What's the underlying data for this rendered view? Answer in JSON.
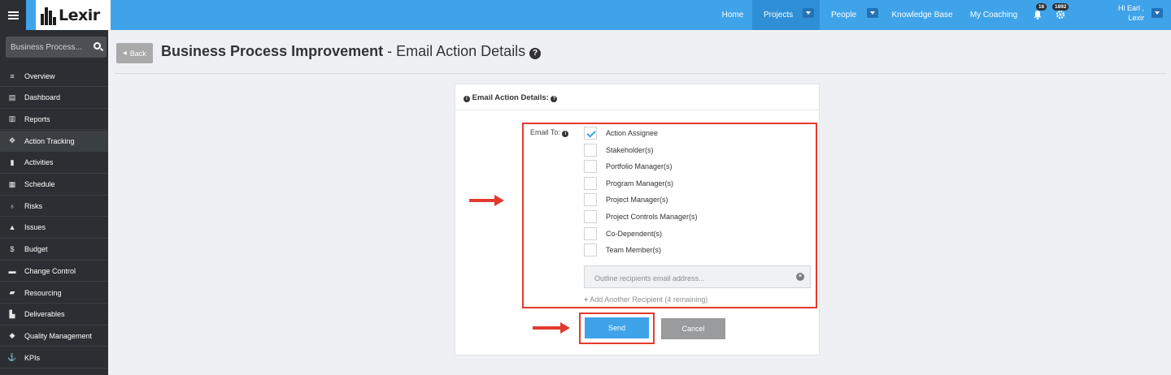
{
  "topbar": {
    "logo_text": "Lexir",
    "nav": [
      {
        "label": "Home"
      },
      {
        "label": "Projects"
      },
      {
        "label": "People"
      },
      {
        "label": "Knowledge Base"
      },
      {
        "label": "My Coaching"
      }
    ],
    "notifications": {
      "alerts_count": "16",
      "settings_count": "1892"
    },
    "greeting_line1": "Hi Earl ,",
    "greeting_line2": "Lexir"
  },
  "sidebar": {
    "search_text": "Business Process...",
    "items": [
      {
        "label": "Overview",
        "icon": "≡"
      },
      {
        "label": "Dashboard",
        "icon": "▤"
      },
      {
        "label": "Reports",
        "icon": "▥"
      },
      {
        "label": "Action Tracking",
        "icon": "✥"
      },
      {
        "label": "Activities",
        "icon": "▮"
      },
      {
        "label": "Schedule",
        "icon": "▦"
      },
      {
        "label": "Risks",
        "icon": "♁"
      },
      {
        "label": "Issues",
        "icon": "▲"
      },
      {
        "label": "Budget",
        "icon": "$"
      },
      {
        "label": "Change Control",
        "icon": "▬"
      },
      {
        "label": "Resourcing",
        "icon": "▰"
      },
      {
        "label": "Deliverables",
        "icon": "▙"
      },
      {
        "label": "Quality Management",
        "icon": "◆"
      },
      {
        "label": "KPIs",
        "icon": "⚓"
      }
    ]
  },
  "header": {
    "back_label": "Back",
    "title_bold": "Business Process Improvement",
    "title_rest": " - Email Action Details "
  },
  "card": {
    "heading": "Email Action Details:",
    "email_to_label": "Email To:",
    "recipients": [
      {
        "label": "Action Assignee",
        "checked": true
      },
      {
        "label": "Stakeholder(s)",
        "checked": false
      },
      {
        "label": "Portfolio Manager(s)",
        "checked": false
      },
      {
        "label": "Program Manager(s)",
        "checked": false
      },
      {
        "label": "Project Manager(s)",
        "checked": false
      },
      {
        "label": "Project Controls Manager(s)",
        "checked": false
      },
      {
        "label": "Co-Dependent(s)",
        "checked": false
      },
      {
        "label": "Team Member(s)",
        "checked": false
      }
    ],
    "email_placeholder": "Outline recipients email address...",
    "add_recipient": "Add Another Recipient (4 remaining)",
    "send_label": "Send",
    "cancel_label": "Cancel"
  },
  "colors": {
    "topbar": "#3fa3ea",
    "sidebar": "#2b2f33",
    "highlight": "#e23b2e",
    "send": "#3fa3ea",
    "cancel": "#999b9d"
  }
}
